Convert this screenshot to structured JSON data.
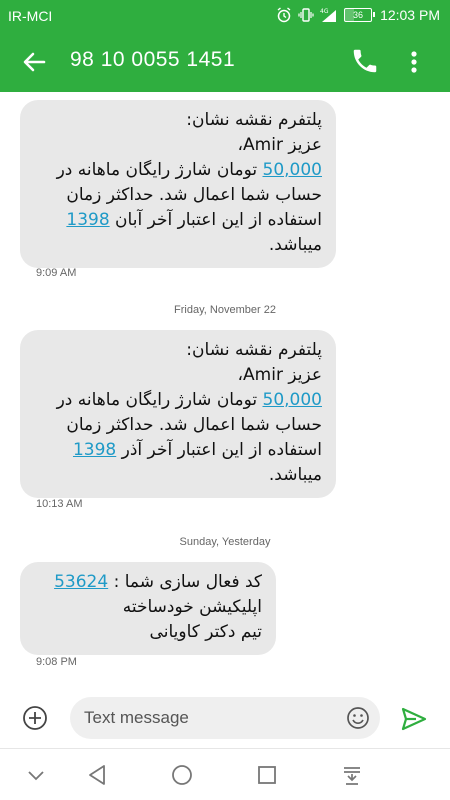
{
  "status_bar": {
    "carrier": "IR-MCI",
    "network": "4G",
    "battery": "36",
    "time": "12:03 PM"
  },
  "header": {
    "title": "98 10 0055 1451",
    "icons": [
      "back-arrow-icon",
      "phone-icon",
      "more-vert-icon"
    ]
  },
  "messages": [
    {
      "lines": [
        "پلتفرم نقشه نشان:",
        "عزیز Amir،",
        "50,000 تومان شارژ رایگان ماهانه در",
        "حساب شما اعمال شد. حداکثر زمان",
        "استفاده از این اعتبار آخر آبان 1398",
        "میباشد."
      ],
      "time": "9:09 AM"
    },
    {
      "day_label": "Friday, November 22",
      "lines": [
        "پلتفرم نقشه نشان:",
        "عزیز Amir،",
        "50,000 تومان شارژ رایگان ماهانه در",
        "حساب شما اعمال شد. حداکثر زمان",
        "استفاده از این اعتبار آخر آذر 1398",
        "میباشد."
      ],
      "time": "10:13 AM"
    },
    {
      "day_label": "Sunday, Yesterday",
      "lines": [
        "کد فعال سازی شما : 53624",
        "اپلیکیشن خودساخته",
        "تیم دکتر کاویانی"
      ],
      "time": "9:08 PM"
    }
  ],
  "composer": {
    "placeholder": "Text message",
    "icons": [
      "add-icon",
      "emoji-icon",
      "send-icon"
    ]
  },
  "nav_bar": {
    "icons": [
      "hide-nav-icon",
      "back-triangle-icon",
      "home-circle-icon",
      "recents-square-icon",
      "notification-pull-icon"
    ]
  },
  "colors": {
    "header": "#2fae3f",
    "bubble": "#e8e8e8",
    "link": "#1f9ac7",
    "send": "#2fae3f"
  }
}
